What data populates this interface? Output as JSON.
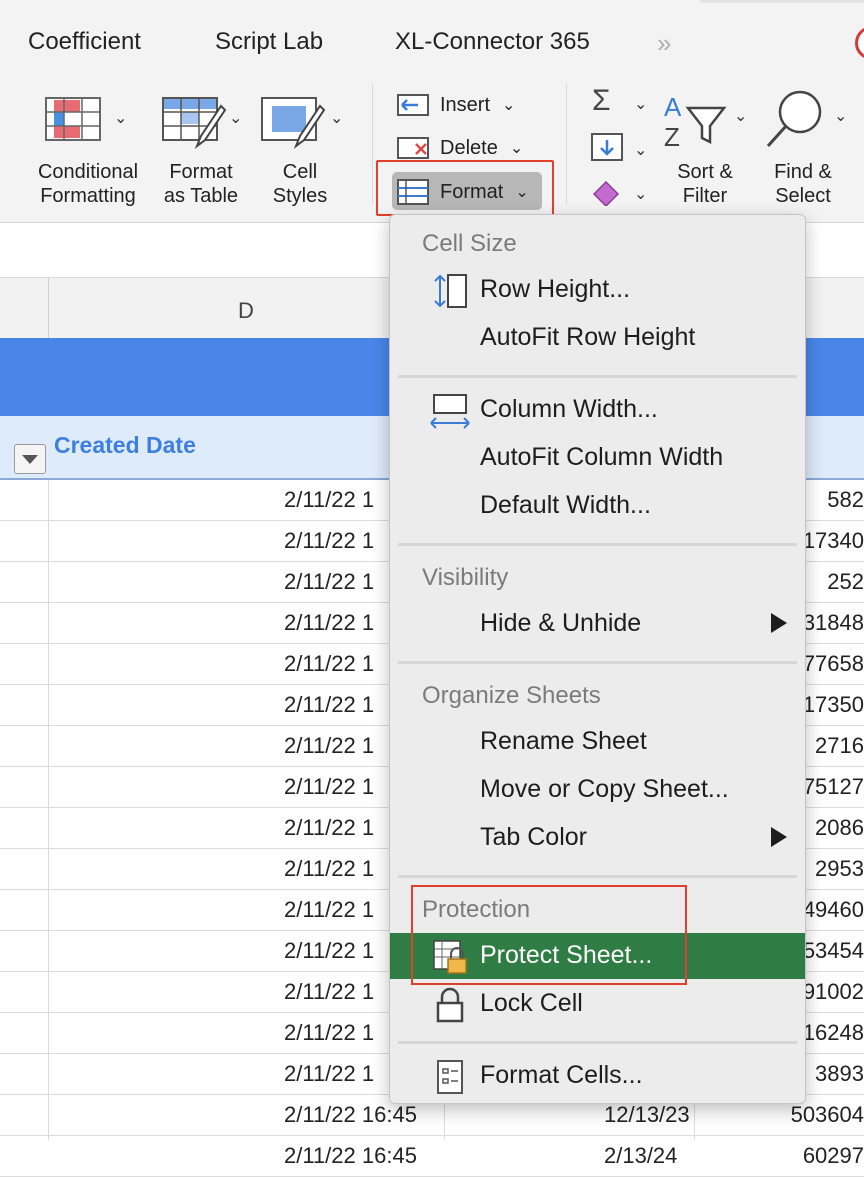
{
  "ribbon": {
    "tabs": [
      "Coefficient",
      "Script Lab",
      "XL-Connector 365"
    ],
    "overflow": "»",
    "styles": {
      "conditional_formatting": [
        "Conditional",
        "Formatting"
      ],
      "format_as_table": [
        "Format",
        "as Table"
      ],
      "cell_styles": [
        "Cell",
        "Styles"
      ]
    },
    "cells": {
      "insert": "Insert",
      "delete": "Delete",
      "format": "Format"
    },
    "editing": {
      "sort_filter": [
        "Sort &",
        "Filter"
      ],
      "find_select": [
        "Find &",
        "Select"
      ]
    }
  },
  "sheet": {
    "column_header": "D",
    "header_label": "Created Date",
    "rows": [
      {
        "date": "2/11/22 1",
        "mid": "",
        "num": "582"
      },
      {
        "date": "2/11/22 1",
        "mid": "",
        "num": "17340"
      },
      {
        "date": "2/11/22 1",
        "mid": "",
        "num": "252"
      },
      {
        "date": "2/11/22 1",
        "mid": "",
        "num": "31848"
      },
      {
        "date": "2/11/22 1",
        "mid": "",
        "num": "77658"
      },
      {
        "date": "2/11/22 1",
        "mid": "",
        "num": "17350"
      },
      {
        "date": "2/11/22 1",
        "mid": "",
        "num": "2716"
      },
      {
        "date": "2/11/22 1",
        "mid": "",
        "num": "75127"
      },
      {
        "date": "2/11/22 1",
        "mid": "",
        "num": "2086"
      },
      {
        "date": "2/11/22 1",
        "mid": "",
        "num": "2953"
      },
      {
        "date": "2/11/22 1",
        "mid": "",
        "num": "49460"
      },
      {
        "date": "2/11/22 1",
        "mid": "",
        "num": "53454"
      },
      {
        "date": "2/11/22 1",
        "mid": "",
        "num": "91002"
      },
      {
        "date": "2/11/22 1",
        "mid": "",
        "num": "16248"
      },
      {
        "date": "2/11/22 1",
        "mid": "",
        "num": "3893"
      },
      {
        "date": "2/11/22 16:45",
        "mid": "12/13/23",
        "num": "503604"
      },
      {
        "date": "2/11/22 16:45",
        "mid": "2/13/24",
        "num": "60297"
      }
    ]
  },
  "menu": {
    "cell_size": {
      "heading": "Cell Size",
      "items": [
        {
          "label": "Row Height...",
          "icon": "row-height-icon"
        },
        {
          "label": "AutoFit Row Height",
          "icon": ""
        }
      ]
    },
    "column": {
      "items": [
        {
          "label": "Column Width...",
          "icon": "column-width-icon"
        },
        {
          "label": "AutoFit Column Width",
          "icon": ""
        },
        {
          "label": "Default Width...",
          "icon": ""
        }
      ]
    },
    "visibility": {
      "heading": "Visibility",
      "items": [
        {
          "label": "Hide & Unhide",
          "submenu": true
        }
      ]
    },
    "organize": {
      "heading": "Organize Sheets",
      "items": [
        {
          "label": "Rename Sheet"
        },
        {
          "label": "Move or Copy Sheet..."
        },
        {
          "label": "Tab Color",
          "submenu": true
        }
      ]
    },
    "protection": {
      "heading": "Protection",
      "items": [
        {
          "label": "Protect Sheet...",
          "icon": "protect-sheet-icon",
          "highlighted": true
        },
        {
          "label": "Lock Cell",
          "icon": "lock-icon"
        }
      ]
    },
    "format_cells": {
      "label": "Format Cells...",
      "icon": "format-cells-icon"
    }
  },
  "colors": {
    "highlight_border": "#e0402c",
    "selected_item": "#2f7d45",
    "table_band": "#4a86e8",
    "header_text": "#3f7fe0"
  }
}
